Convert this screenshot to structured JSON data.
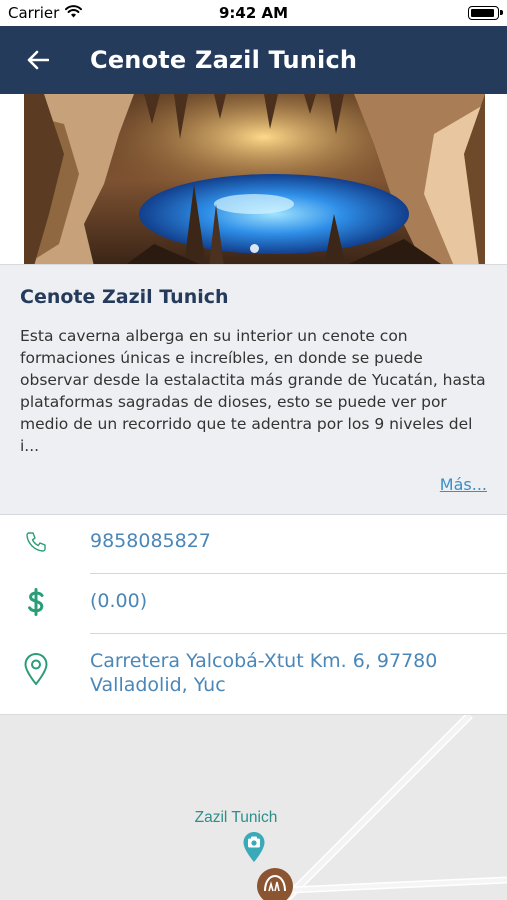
{
  "status_bar": {
    "carrier": "Carrier",
    "time": "9:42 AM",
    "icons": [
      "wifi-icon",
      "battery-icon"
    ]
  },
  "nav": {
    "title": "Cenote Zazil Tunich",
    "back_icon": "arrow-left-icon"
  },
  "hero": {
    "image": "cave-cenote-photo",
    "carousel_pages": 1,
    "active_page": 1
  },
  "info": {
    "title": "Cenote Zazil Tunich",
    "description": "Esta caverna alberga en su interior un cenote con formaciones únicas e increíbles, en donde se puede observar desde la estalactita más grande de Yucatán, hasta plataformas sagradas de dioses, esto se puede ver por medio de un recorrido que te adentra por los 9 niveles del i...",
    "more_label": "Más..."
  },
  "details": {
    "phone": "9858085827",
    "price": "(0.00)",
    "address_line1": "Carretera Yalcobá-Xtut Km. 6, 97780",
    "address_line2": "Valladolid, Yuc",
    "icons": [
      "phone-icon",
      "dollar-icon",
      "location-pin-icon"
    ]
  },
  "map": {
    "marker_label": "Zazil Tunich",
    "marker_icon": "camera-pin-icon",
    "poi_icon": "cave-poi-icon"
  },
  "colors": {
    "nav_bg": "#253b5c",
    "title": "#253b5c",
    "link": "#3a8fc7",
    "detail_text": "#4a87b8",
    "icon_green": "#2a9d78",
    "map_label": "#2b8f8a"
  }
}
